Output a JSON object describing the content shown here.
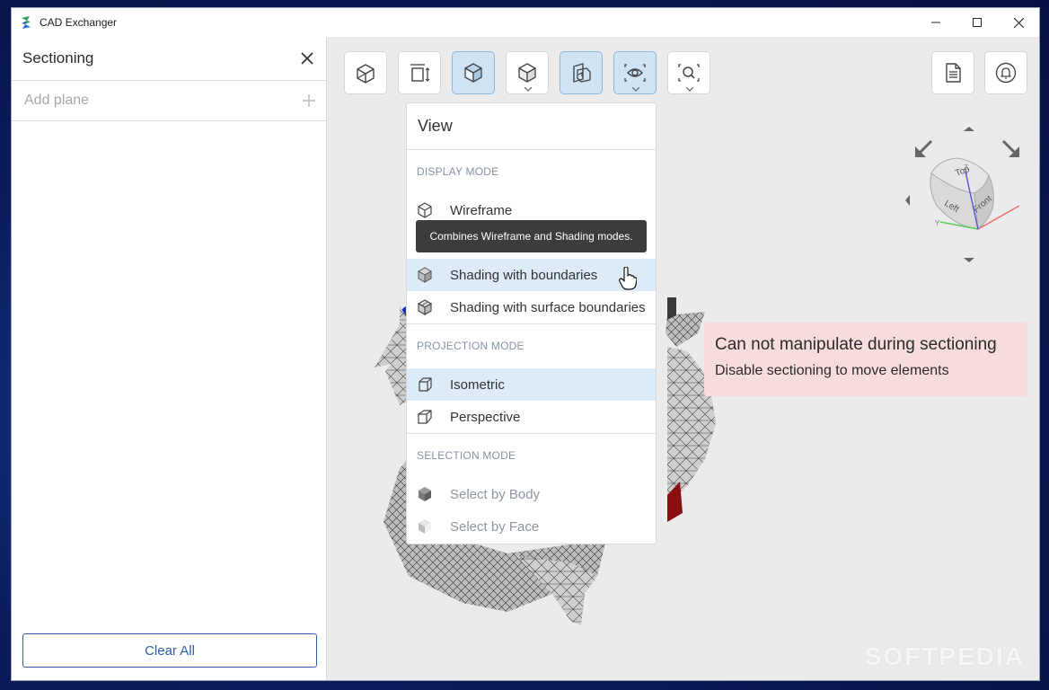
{
  "window": {
    "title": "CAD Exchanger"
  },
  "sidebar": {
    "title": "Sectioning",
    "add_plane_placeholder": "Add plane",
    "clear_all_label": "Clear All"
  },
  "toolbar": {
    "buttons": [
      {
        "icon": "box-wireframe-icon",
        "active": false
      },
      {
        "icon": "fit-dimensions-icon",
        "active": false
      },
      {
        "icon": "cube-shaded-icon",
        "active": true
      },
      {
        "icon": "display-mode-icon",
        "active": false
      },
      {
        "icon": "section-plane-icon",
        "active": true
      },
      {
        "icon": "view-eye-icon",
        "active": true
      },
      {
        "icon": "search-zoom-icon",
        "active": false
      }
    ],
    "right_buttons": [
      {
        "icon": "document-icon"
      },
      {
        "icon": "notification-icon"
      }
    ]
  },
  "view_menu": {
    "title": "View",
    "display_mode_header": "DISPLAY MODE",
    "display_items": [
      "Wireframe",
      "Shading with boundaries",
      "Shading with surface boundaries"
    ],
    "projection_mode_header": "PROJECTION MODE",
    "projection_items": [
      "Isometric",
      "Perspective"
    ],
    "selection_mode_header": "SELECTION MODE",
    "selection_items": [
      "Select by Body",
      "Select by Face"
    ],
    "highlighted": [
      "Shading with boundaries",
      "Isometric"
    ]
  },
  "tooltip": {
    "text": "Combines Wireframe and Shading modes."
  },
  "notice": {
    "title": "Can not manipulate during sectioning",
    "text": "Disable sectioning to move elements"
  },
  "navcube": {
    "faces": [
      "Top",
      "Left",
      "Front"
    ],
    "axes": [
      "X",
      "Y",
      "Z"
    ]
  },
  "watermark": "SOFTPEDIA",
  "colors": {
    "accent": "#2f5ca8",
    "active_button": "#cfe3f4",
    "highlight": "#dcebf7",
    "notice_bg": "#f7dcdc"
  }
}
